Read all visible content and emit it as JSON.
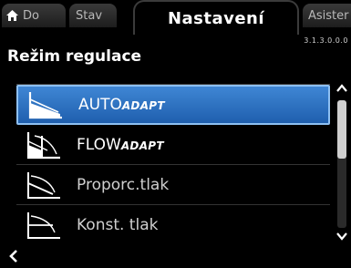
{
  "tabs": {
    "home": "Do",
    "status": "Stav",
    "settings": "Nastavení",
    "assist": "Asister"
  },
  "menu_code": "3.1.3.0.0.0",
  "page_title": "Režim regulace",
  "items": [
    {
      "main": "AUTO",
      "suffix": "ADAPT",
      "selected": true,
      "icon": "auto-adapt-curve-icon"
    },
    {
      "main": "FLOW",
      "suffix": "ADAPT",
      "selected": false,
      "icon": "flow-adapt-curve-icon"
    },
    {
      "main": "Proporc.tlak",
      "suffix": "",
      "selected": false,
      "icon": "proportional-pressure-curve-icon"
    },
    {
      "main": "Konst. tlak",
      "suffix": "",
      "selected": false,
      "icon": "constant-pressure-curve-icon"
    }
  ],
  "colors": {
    "selection": "#2f74c6",
    "selection_border": "#8ec0f2",
    "background": "#000000"
  }
}
